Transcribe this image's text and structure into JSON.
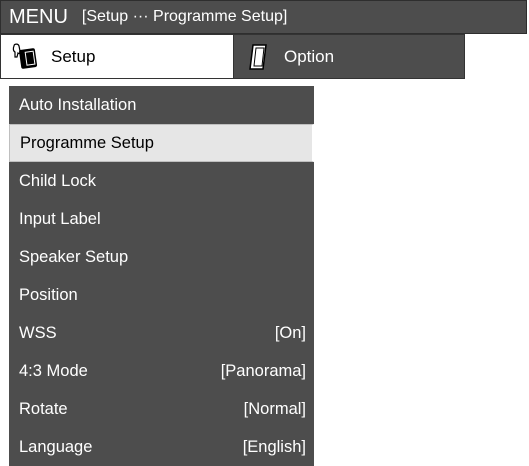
{
  "header": {
    "menu_label": "MENU",
    "breadcrumb": "[Setup ··· Programme Setup]"
  },
  "tabs": [
    {
      "label": "Setup",
      "icon": "setup-tools-icon",
      "active": true
    },
    {
      "label": "Option",
      "icon": "option-card-icon",
      "active": false
    }
  ],
  "menu": {
    "items": [
      {
        "label": "Auto Installation",
        "value": ""
      },
      {
        "label": "Programme Setup",
        "value": "",
        "selected": true
      },
      {
        "label": "Child Lock",
        "value": ""
      },
      {
        "label": "Input Label",
        "value": ""
      },
      {
        "label": "Speaker Setup",
        "value": ""
      },
      {
        "label": "Position",
        "value": ""
      },
      {
        "label": "WSS",
        "value": "[On]"
      },
      {
        "label": "4:3 Mode",
        "value": "[Panorama]"
      },
      {
        "label": "Rotate",
        "value": "[Normal]"
      },
      {
        "label": "Language",
        "value": "[English]"
      }
    ]
  },
  "colors": {
    "panel": "#4d4d4d",
    "highlight": "#e6e6e6",
    "text_light": "#ffffff",
    "text_dark": "#000000"
  }
}
